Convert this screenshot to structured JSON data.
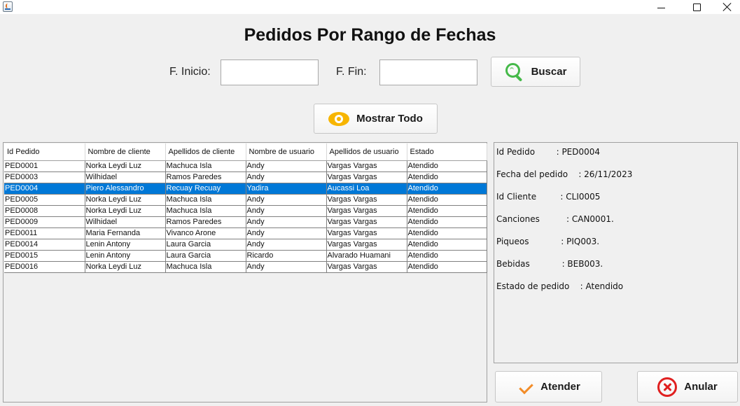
{
  "window": {
    "title_icon": "java-cup-icon"
  },
  "header": {
    "title": "Pedidos Por Rango de Fechas"
  },
  "filters": {
    "inicio_label": "F. Inicio:",
    "inicio_value": "",
    "fin_label": "F. Fin:",
    "fin_value": "",
    "buscar_label": "Buscar",
    "mostrar_todo_label": "Mostrar Todo"
  },
  "table": {
    "columns": [
      "Id Pedido",
      "Nombre de cliente",
      "Apellidos de cliente",
      "Nombre de usuario",
      "Apellidos de usuario",
      "Estado"
    ],
    "rows": [
      [
        "PED0001",
        "Norka Leydi Luz",
        "Machuca Isla",
        "Andy",
        "Vargas Vargas",
        "Atendido"
      ],
      [
        "PED0003",
        "Wilhidael",
        "Ramos Paredes",
        "Andy",
        "Vargas Vargas",
        "Atendido"
      ],
      [
        "PED0004",
        "Piero Alessandro",
        "Recuay Recuay",
        "Yadira",
        "Aucassi Loa",
        "Atendido"
      ],
      [
        "PED0005",
        "Norka Leydi Luz",
        "Machuca Isla",
        "Andy",
        "Vargas Vargas",
        "Atendido"
      ],
      [
        "PED0008",
        "Norka Leydi Luz",
        "Machuca Isla",
        "Andy",
        "Vargas Vargas",
        "Atendido"
      ],
      [
        "PED0009",
        "Wilhidael",
        "Ramos Paredes",
        "Andy",
        "Vargas Vargas",
        "Atendido"
      ],
      [
        "PED0011",
        "Maria Fernanda",
        "Vivanco Arone",
        "Andy",
        "Vargas Vargas",
        "Atendido"
      ],
      [
        "PED0014",
        "Lenin Antony",
        "Laura Garcia",
        "Andy",
        "Vargas Vargas",
        "Atendido"
      ],
      [
        "PED0015",
        "Lenin Antony",
        "Laura Garcia",
        "Ricardo",
        "Alvarado Huamani",
        "Atendido"
      ],
      [
        "PED0016",
        "Norka Leydi Luz",
        "Machuca Isla",
        "Andy",
        "Vargas Vargas",
        "Atendido"
      ]
    ],
    "selected_row_index": 2,
    "selection_color": "#0078d7"
  },
  "detail": {
    "lines": [
      "Id Pedido        : PED0004",
      "Fecha del pedido    : 26/11/2023",
      "Id Cliente         : CLI0005",
      "Canciones          : CAN0001.",
      "Piqueos            : PIQ003.",
      "Bebidas            : BEB003.",
      "Estado de pedido    : Atendido"
    ]
  },
  "actions": {
    "atender_label": "Atender",
    "anular_label": "Anular"
  },
  "colors": {
    "search_icon": "#45b949",
    "eye_icon": "#f7b500",
    "check_icon": "#f28c28",
    "cancel_icon": "#e02020"
  }
}
